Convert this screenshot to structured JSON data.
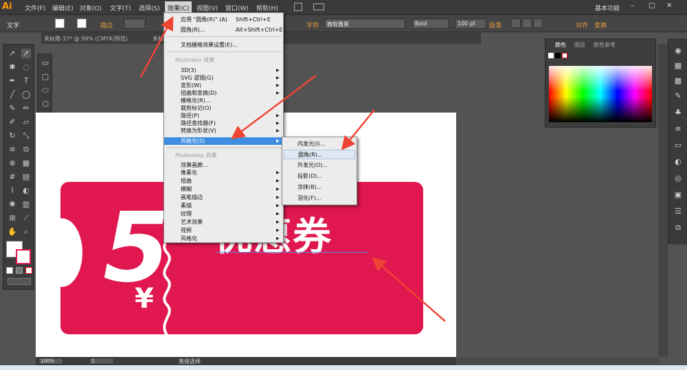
{
  "app": {
    "logo": "Ai",
    "workspace": "基本功能"
  },
  "menubar": [
    "文件(F)",
    "编辑(E)",
    "对象(O)",
    "文字(T)",
    "选择(S)",
    "效果(C)",
    "视图(V)",
    "窗口(W)",
    "帮助(H)"
  ],
  "control_bar": {
    "tool_name": "文字",
    "stroke_label": "描边",
    "char_label": "字符",
    "font_value": "微软雅黑",
    "style_value": "Bold",
    "size_value": "100 pt",
    "para_label": "段落",
    "align_label": "对齐",
    "transform_label": "变换"
  },
  "doc_tabs": [
    "未标题-37* @ 99% (CMYK/预览)",
    "未标"
  ],
  "effect_menu": {
    "apply_label": "应用 \"圆角(R)\" (A)",
    "apply_shortcut": "Shift+Ctrl+E",
    "last_label": "圆角(R)...",
    "last_shortcut": "Alt+Shift+Ctrl+E",
    "raster_settings": "文档栅格效果设置(E)...",
    "illustrator_header": "Illustrator 效果",
    "illustrator_items": [
      "3D(3)",
      "SVG 滤镜(G)",
      "变形(W)",
      "扭曲和变换(D)",
      "栅格化(R)...",
      "裁剪标记(O)",
      "路径(P)",
      "路径查找器(F)",
      "转换为形状(V)",
      "风格化(S)"
    ],
    "photoshop_header": "Photoshop 效果",
    "photoshop_items": [
      "效果画廊...",
      "像素化",
      "扭曲",
      "模糊",
      "画笔描边",
      "素描",
      "纹理",
      "艺术效果",
      "视频",
      "风格化"
    ]
  },
  "stylize_submenu": [
    "内发光(I)...",
    "圆角(R)...",
    "外发光(O)...",
    "投影(D)...",
    "涂抹(B)...",
    "羽化(F)..."
  ],
  "color_panel": {
    "tabs": [
      "颜色",
      "图层",
      "颜色参考"
    ]
  },
  "canvas": {
    "coupon_amount": "5",
    "currency": "¥",
    "coupon_text": "优惠券",
    "coupon_color": "#e0184f"
  },
  "statusbar": {
    "zoom": "100%",
    "page": "1",
    "tool": "直接选择"
  },
  "colors": {
    "accent_arrow": "#ee4433",
    "menu_highlight": "#3e8de0"
  }
}
